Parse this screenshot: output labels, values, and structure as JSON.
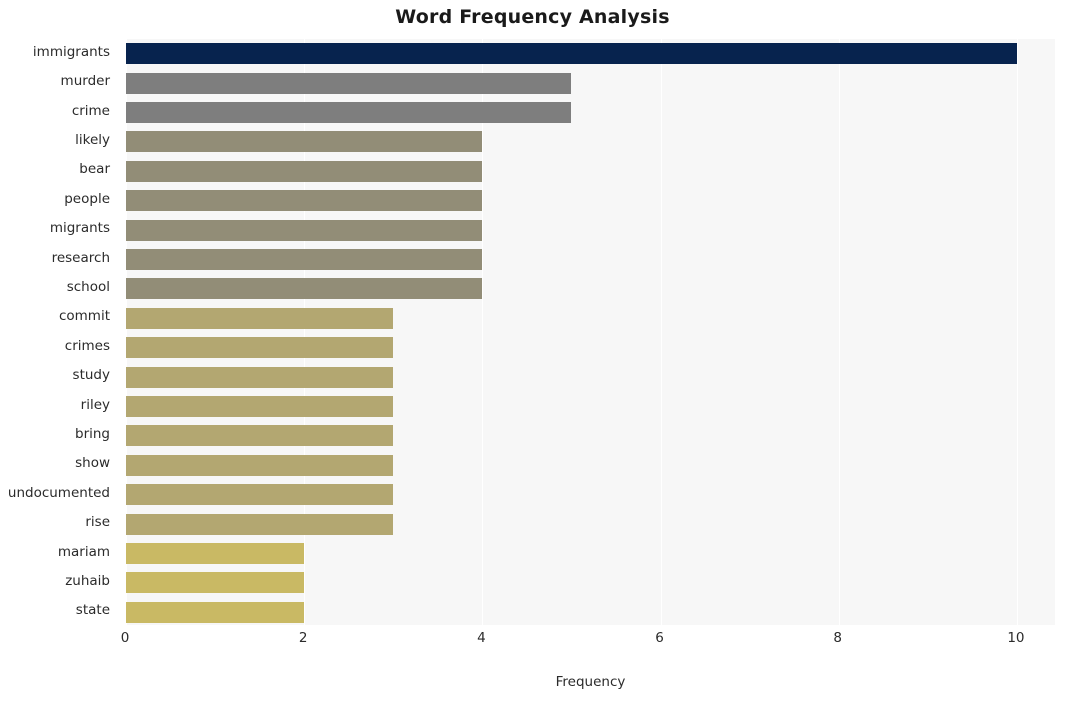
{
  "chart_data": {
    "type": "bar",
    "orientation": "horizontal",
    "title": "Word Frequency Analysis",
    "xlabel": "Frequency",
    "ylabel": "",
    "xlim": [
      0,
      10.45
    ],
    "xticks": [
      0,
      2,
      4,
      6,
      8,
      10
    ],
    "grid": true,
    "grid_axis": "x",
    "legend": false,
    "plot_background": "#f7f7f7",
    "categories": [
      "immigrants",
      "murder",
      "crime",
      "likely",
      "bear",
      "people",
      "migrants",
      "research",
      "school",
      "commit",
      "crimes",
      "study",
      "riley",
      "bring",
      "show",
      "undocumented",
      "rise",
      "mariam",
      "zuhaib",
      "state"
    ],
    "values": [
      10,
      5,
      5,
      4,
      4,
      4,
      4,
      4,
      4,
      3,
      3,
      3,
      3,
      3,
      3,
      3,
      3,
      2,
      2,
      2
    ],
    "bar_colors": [
      "#07234e",
      "#7e7e7e",
      "#7e7e7e",
      "#928d77",
      "#928d77",
      "#928d77",
      "#928d77",
      "#928d77",
      "#928d77",
      "#b3a771",
      "#b3a771",
      "#b3a771",
      "#b3a771",
      "#b3a771",
      "#b3a771",
      "#b3a771",
      "#b3a771",
      "#c9b964",
      "#c9b964",
      "#c9b964"
    ]
  }
}
